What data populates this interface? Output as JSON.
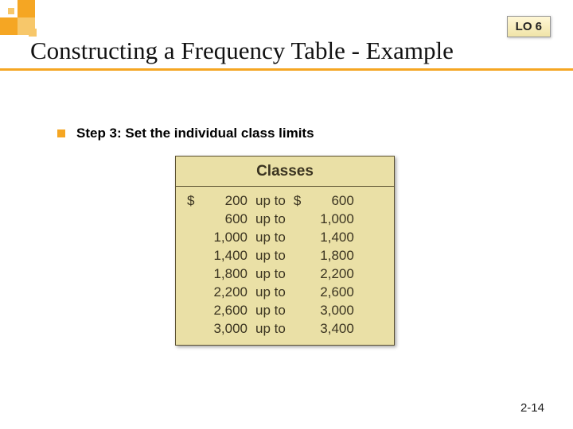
{
  "badge": "LO 6",
  "title": "Constructing a Frequency Table - Example",
  "step_text": "Step 3: Set the individual class limits",
  "classes_header": "Classes",
  "mid_label": "up to",
  "currency": "$",
  "classes": [
    {
      "lower": "200",
      "upper": "600",
      "lead_l": true,
      "lead_r": true
    },
    {
      "lower": "600",
      "upper": "1,000",
      "lead_l": false,
      "lead_r": false
    },
    {
      "lower": "1,000",
      "upper": "1,400",
      "lead_l": false,
      "lead_r": false
    },
    {
      "lower": "1,400",
      "upper": "1,800",
      "lead_l": false,
      "lead_r": false
    },
    {
      "lower": "1,800",
      "upper": "2,200",
      "lead_l": false,
      "lead_r": false
    },
    {
      "lower": "2,200",
      "upper": "2,600",
      "lead_l": false,
      "lead_r": false
    },
    {
      "lower": "2,600",
      "upper": "3,000",
      "lead_l": false,
      "lead_r": false
    },
    {
      "lower": "3,000",
      "upper": "3,400",
      "lead_l": false,
      "lead_r": false
    }
  ],
  "page_number": "2-14"
}
